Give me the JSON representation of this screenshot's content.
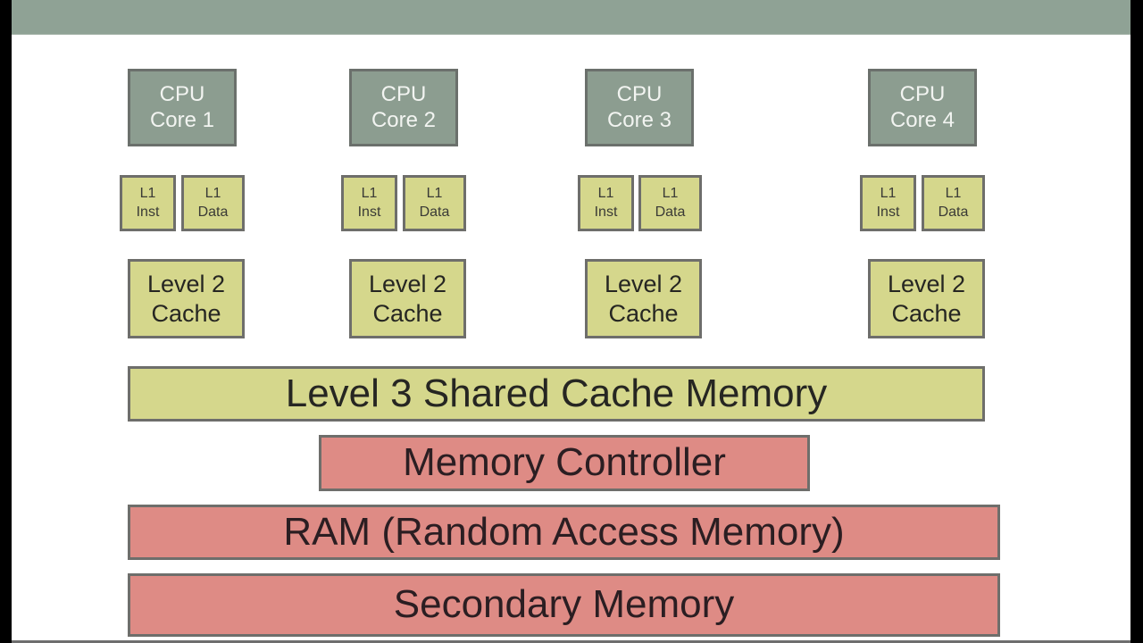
{
  "diagram": {
    "type": "memory-hierarchy",
    "colors": {
      "header_band": "#8fa295",
      "cpu_core": "#8c9d90",
      "cache": "#d5d78c",
      "memory": "#de8b85",
      "border": "#6e6e6b"
    },
    "cores": [
      {
        "cpu_line1": "CPU",
        "cpu_line2": "Core 1",
        "l1_inst": [
          "L1",
          "Inst"
        ],
        "l1_data": [
          "L1",
          "Data"
        ],
        "l2": [
          "Level 2",
          "Cache"
        ]
      },
      {
        "cpu_line1": "CPU",
        "cpu_line2": "Core 2",
        "l1_inst": [
          "L1",
          "Inst"
        ],
        "l1_data": [
          "L1",
          "Data"
        ],
        "l2": [
          "Level 2",
          "Cache"
        ]
      },
      {
        "cpu_line1": "CPU",
        "cpu_line2": "Core 3",
        "l1_inst": [
          "L1",
          "Inst"
        ],
        "l1_data": [
          "L1",
          "Data"
        ],
        "l2": [
          "Level 2",
          "Cache"
        ]
      },
      {
        "cpu_line1": "CPU",
        "cpu_line2": "Core 4",
        "l1_inst": [
          "L1",
          "Inst"
        ],
        "l1_data": [
          "L1",
          "Data"
        ],
        "l2": [
          "Level 2",
          "Cache"
        ]
      }
    ],
    "shared_layers": {
      "l3": "Level 3 Shared Cache Memory",
      "memory_controller": "Memory Controller",
      "ram": "RAM (Random Access Memory)",
      "secondary": "Secondary Memory"
    }
  }
}
